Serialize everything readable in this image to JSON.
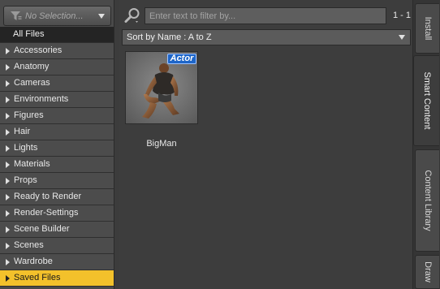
{
  "selector": {
    "placeholder": "No Selection...",
    "icon": "funnel-icon"
  },
  "categories": [
    {
      "label": "All Files",
      "expandable": false
    },
    {
      "label": "Accessories",
      "expandable": true
    },
    {
      "label": "Anatomy",
      "expandable": true
    },
    {
      "label": "Cameras",
      "expandable": true
    },
    {
      "label": "Environments",
      "expandable": true
    },
    {
      "label": "Figures",
      "expandable": true
    },
    {
      "label": "Hair",
      "expandable": true
    },
    {
      "label": "Lights",
      "expandable": true
    },
    {
      "label": "Materials",
      "expandable": true
    },
    {
      "label": "Props",
      "expandable": true
    },
    {
      "label": "Ready to Render",
      "expandable": true
    },
    {
      "label": "Render-Settings",
      "expandable": true
    },
    {
      "label": "Scene Builder",
      "expandable": true
    },
    {
      "label": "Scenes",
      "expandable": true
    },
    {
      "label": "Wardrobe",
      "expandable": true
    },
    {
      "label": "Saved Files",
      "expandable": true,
      "selected": true
    }
  ],
  "filter": {
    "placeholder": "Enter text to filter by...",
    "value": "",
    "count": "1 - 1"
  },
  "sort": {
    "label": "Sort by Name : A to Z"
  },
  "items": [
    {
      "name": "BigMan",
      "badge": "Actor"
    }
  ],
  "tabs": [
    {
      "label": "Install",
      "active": false
    },
    {
      "label": "Smart Content",
      "active": true
    },
    {
      "label": "Content Library",
      "active": false
    },
    {
      "label": "Draw",
      "active": false
    }
  ],
  "colors": {
    "selected_row": "#f3c12b",
    "badge": "#1e66c9"
  }
}
